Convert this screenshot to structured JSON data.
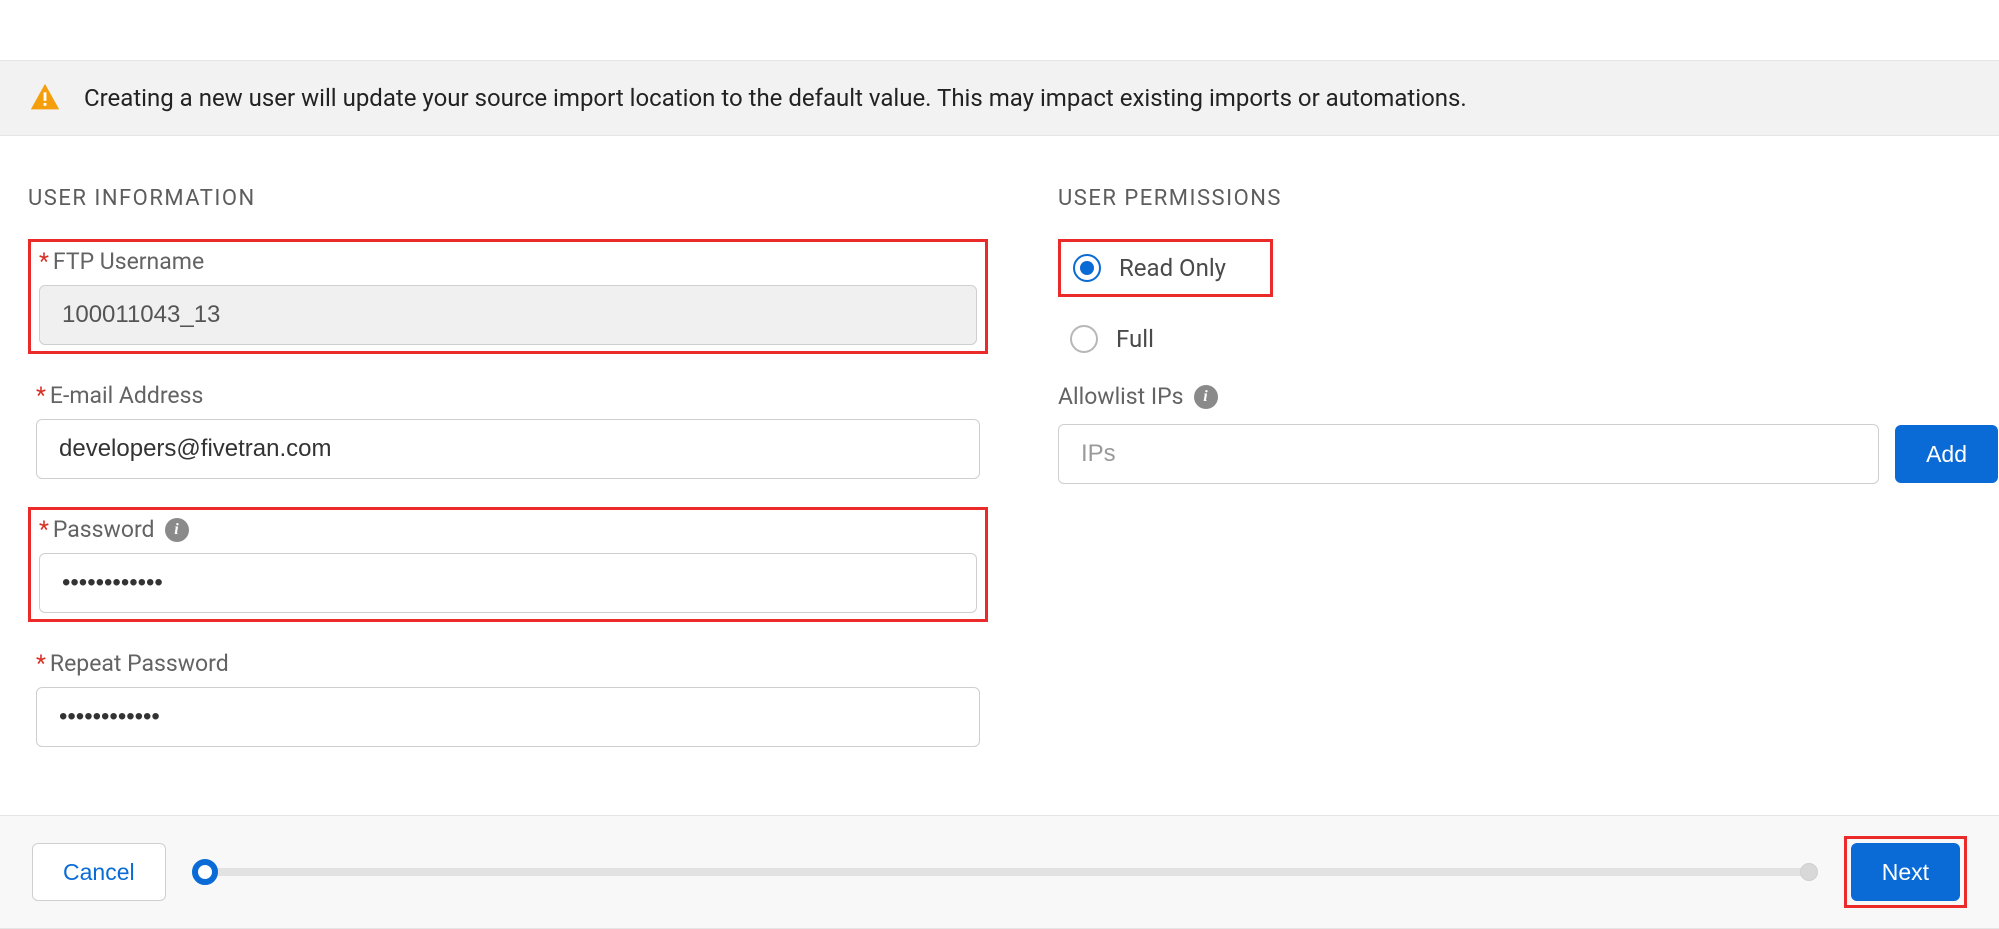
{
  "alert": {
    "message": "Creating a new user will update your source import location to the default value. This may impact existing imports or automations."
  },
  "sections": {
    "user_info_title": "USER INFORMATION",
    "user_perm_title": "USER PERMISSIONS"
  },
  "fields": {
    "ftp_username": {
      "label": "FTP Username",
      "value": "100011043_13"
    },
    "email": {
      "label": "E-mail Address",
      "value": "developers@fivetran.com"
    },
    "password": {
      "label": "Password",
      "value": "••••••••••••"
    },
    "repeat_pw": {
      "label": "Repeat Password",
      "value": "••••••••••••"
    }
  },
  "permissions": {
    "options": [
      {
        "label": "Read Only",
        "selected": true
      },
      {
        "label": "Full",
        "selected": false
      }
    ],
    "allowlist_label": "Allowlist IPs",
    "allowlist_placeholder": "IPs",
    "add_label": "Add"
  },
  "footer": {
    "cancel_label": "Cancel",
    "next_label": "Next"
  }
}
